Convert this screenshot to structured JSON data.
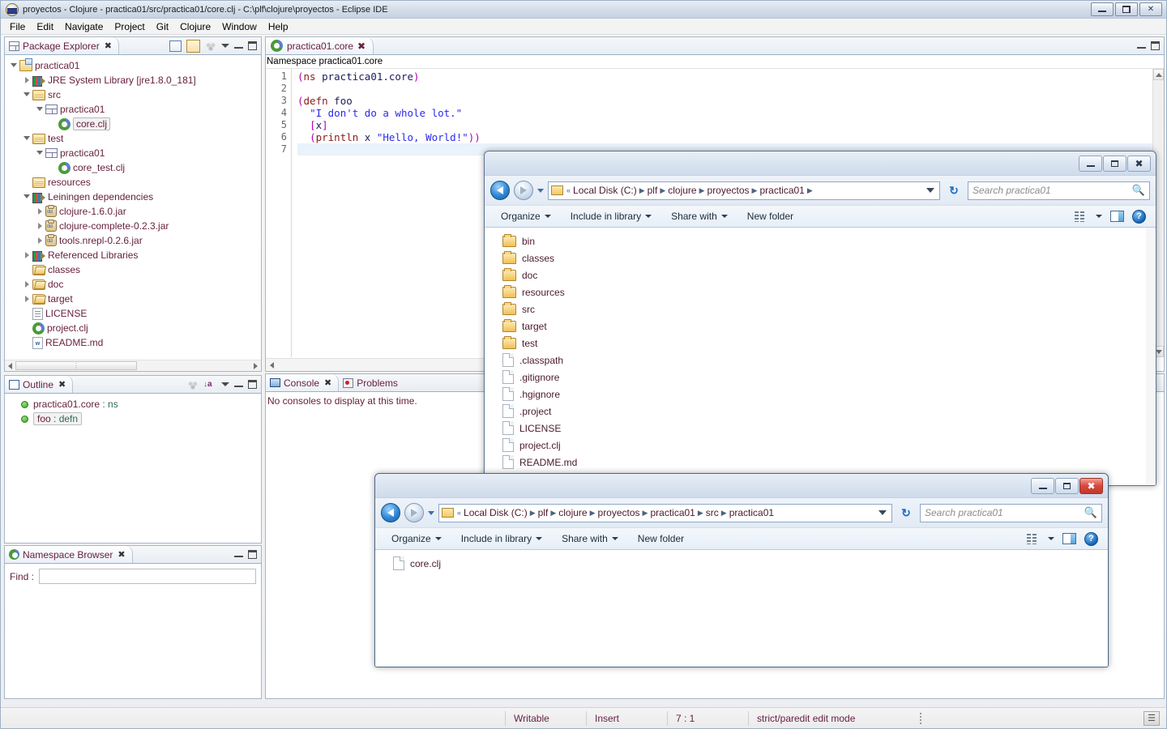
{
  "eclipse": {
    "title": "proyectos - Clojure - practica01/src/practica01/core.clj - C:\\plf\\clojure\\proyectos - Eclipse IDE",
    "menus": [
      "File",
      "Edit",
      "Navigate",
      "Project",
      "Git",
      "Clojure",
      "Window",
      "Help"
    ],
    "window_buttons": {
      "minimize": "minimize-icon",
      "restore": "restore-icon",
      "close": "close-icon"
    }
  },
  "package_explorer": {
    "tab_label": "Package Explorer",
    "tree": [
      {
        "label": "practica01",
        "indent": 0,
        "arrow": "expanded",
        "icon": "project-icon"
      },
      {
        "label": "JRE System Library [jre1.8.0_181]",
        "indent": 1,
        "arrow": "collapsed",
        "icon": "library-icon"
      },
      {
        "label": "src",
        "indent": 1,
        "arrow": "expanded",
        "icon": "package-root-icon"
      },
      {
        "label": "practica01",
        "indent": 2,
        "arrow": "expanded",
        "icon": "package-icon"
      },
      {
        "label": "core.clj",
        "indent": 3,
        "arrow": "none",
        "icon": "clojure-icon",
        "selected": true
      },
      {
        "label": "test",
        "indent": 1,
        "arrow": "expanded",
        "icon": "package-root-icon"
      },
      {
        "label": "practica01",
        "indent": 2,
        "arrow": "expanded",
        "icon": "package-icon"
      },
      {
        "label": "core_test.clj",
        "indent": 3,
        "arrow": "none",
        "icon": "clojure-icon"
      },
      {
        "label": "resources",
        "indent": 1,
        "arrow": "none",
        "icon": "package-root-icon"
      },
      {
        "label": "Leiningen dependencies",
        "indent": 1,
        "arrow": "expanded",
        "icon": "library-icon"
      },
      {
        "label": "clojure-1.6.0.jar",
        "indent": 2,
        "arrow": "collapsed",
        "icon": "jar-icon"
      },
      {
        "label": "clojure-complete-0.2.3.jar",
        "indent": 2,
        "arrow": "collapsed",
        "icon": "jar-icon"
      },
      {
        "label": "tools.nrepl-0.2.6.jar",
        "indent": 2,
        "arrow": "collapsed",
        "icon": "jar-icon"
      },
      {
        "label": "Referenced Libraries",
        "indent": 1,
        "arrow": "collapsed",
        "icon": "library-icon"
      },
      {
        "label": "classes",
        "indent": 1,
        "arrow": "none",
        "icon": "folder-open-icon"
      },
      {
        "label": "doc",
        "indent": 1,
        "arrow": "collapsed",
        "icon": "folder-open-icon"
      },
      {
        "label": "target",
        "indent": 1,
        "arrow": "collapsed",
        "icon": "folder-open-icon"
      },
      {
        "label": "LICENSE",
        "indent": 1,
        "arrow": "none",
        "icon": "text-file-icon"
      },
      {
        "label": "project.clj",
        "indent": 1,
        "arrow": "none",
        "icon": "clojure-icon"
      },
      {
        "label": "README.md",
        "indent": 1,
        "arrow": "none",
        "icon": "markdown-file-icon"
      }
    ]
  },
  "outline": {
    "tab_label": "Outline",
    "items": [
      {
        "name": "practica01.core",
        "kind": ": ns",
        "selected": false
      },
      {
        "name": "foo",
        "kind": ": defn",
        "selected": true
      }
    ]
  },
  "namespace_browser": {
    "tab_label": "Namespace Browser",
    "find_label": "Find :",
    "find_value": ""
  },
  "editor": {
    "tab_label": "practica01.core",
    "namespace_bar": "Namespace practica01.core",
    "line_numbers": [
      "1",
      "2",
      "3",
      "4",
      "5",
      "6",
      "7"
    ],
    "lines": [
      [
        {
          "t": "(",
          "c": "p"
        },
        {
          "t": "ns ",
          "c": "kw"
        },
        {
          "t": "practica01.core",
          "c": "sym"
        },
        {
          "t": ")",
          "c": "p"
        }
      ],
      [],
      [
        {
          "t": "(",
          "c": "p"
        },
        {
          "t": "defn ",
          "c": "kw"
        },
        {
          "t": "foo",
          "c": "sym"
        }
      ],
      [
        {
          "t": "  ",
          "c": "sym"
        },
        {
          "t": "\"I don't do a whole lot.\"",
          "c": "str"
        }
      ],
      [
        {
          "t": "  ",
          "c": "sym"
        },
        {
          "t": "[",
          "c": "p"
        },
        {
          "t": "x",
          "c": "sym"
        },
        {
          "t": "]",
          "c": "p"
        }
      ],
      [
        {
          "t": "  ",
          "c": "sym"
        },
        {
          "t": "(",
          "c": "p"
        },
        {
          "t": "println",
          "c": "kw"
        },
        {
          "t": " x ",
          "c": "sym"
        },
        {
          "t": "\"Hello, World!\"",
          "c": "str"
        },
        {
          "t": "))",
          "c": "p"
        }
      ],
      []
    ],
    "cursor_line_index": 6
  },
  "console": {
    "tabs": [
      {
        "label": "Console",
        "active": true,
        "icon": "console-icon"
      },
      {
        "label": "Problems",
        "active": false,
        "icon": "problems-icon"
      }
    ],
    "message": "No consoles to display at this time."
  },
  "status_bar": {
    "cells": [
      "Writable",
      "Insert",
      "7 : 1",
      "strict/paredit edit mode"
    ]
  },
  "explorer_back": {
    "breadcrumbs": [
      "Local Disk (C:)",
      "plf",
      "clojure",
      "proyectos",
      "practica01"
    ],
    "prefix": "«",
    "search_placeholder": "Search practica01",
    "toolbar": [
      "Organize",
      "Include in library",
      "Share with",
      "New folder"
    ],
    "items": [
      {
        "name": "bin",
        "type": "folder"
      },
      {
        "name": "classes",
        "type": "folder"
      },
      {
        "name": "doc",
        "type": "folder"
      },
      {
        "name": "resources",
        "type": "folder"
      },
      {
        "name": "src",
        "type": "folder"
      },
      {
        "name": "target",
        "type": "folder"
      },
      {
        "name": "test",
        "type": "folder"
      },
      {
        "name": ".classpath",
        "type": "file"
      },
      {
        "name": ".gitignore",
        "type": "file"
      },
      {
        "name": ".hgignore",
        "type": "file"
      },
      {
        "name": ".project",
        "type": "file"
      },
      {
        "name": "LICENSE",
        "type": "file"
      },
      {
        "name": "project.clj",
        "type": "file"
      },
      {
        "name": "README.md",
        "type": "file"
      }
    ]
  },
  "explorer_front": {
    "breadcrumbs": [
      "Local Disk (C:)",
      "plf",
      "clojure",
      "proyectos",
      "practica01",
      "src",
      "practica01"
    ],
    "prefix": "«",
    "search_placeholder": "Search practica01",
    "toolbar": [
      "Organize",
      "Include in library",
      "Share with",
      "New folder"
    ],
    "items": [
      {
        "name": "core.clj",
        "type": "file"
      }
    ]
  },
  "colors": {
    "accent_blue": "#2d86d6",
    "tab_text": "#68203f",
    "close_red": "#c0392b",
    "paren_magenta": "#b000b0",
    "keyword_maroon": "#8b1a1a",
    "string_blue": "#2a2af0"
  }
}
